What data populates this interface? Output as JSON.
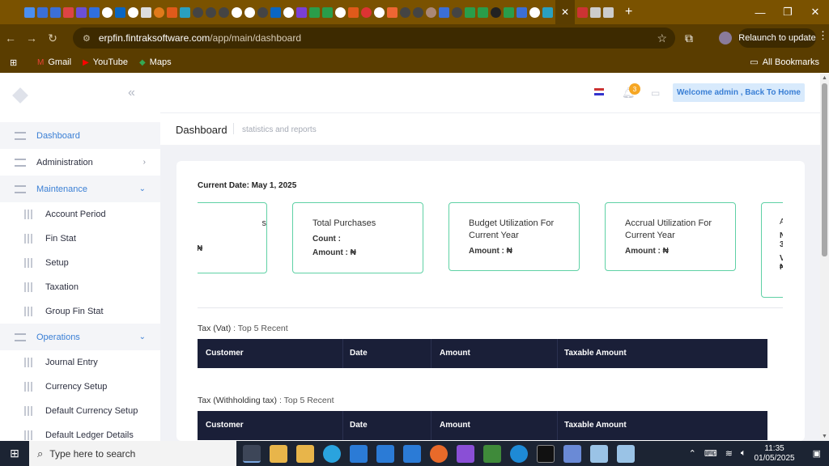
{
  "browser": {
    "url_host": "erpfin.fintraksoftware.com",
    "url_path": "/app/main/dashboard",
    "relaunch_label": "Relaunch to update",
    "bookmarks": [
      {
        "label": "Gmail",
        "icon": "gmail-icon"
      },
      {
        "label": "YouTube",
        "icon": "youtube-icon"
      },
      {
        "label": "Maps",
        "icon": "maps-icon"
      }
    ],
    "all_bookmarks_label": "All Bookmarks"
  },
  "sidebar": {
    "items": [
      {
        "label": "Dashboard",
        "type": "top",
        "active": true
      },
      {
        "label": "Administration",
        "type": "top",
        "chevron": "›"
      },
      {
        "label": "Maintenance",
        "type": "top",
        "active": true,
        "chevron": "⌄"
      },
      {
        "label": "Account Period",
        "type": "sub"
      },
      {
        "label": "Fin Stat",
        "type": "sub"
      },
      {
        "label": "Setup",
        "type": "sub"
      },
      {
        "label": "Taxation",
        "type": "sub"
      },
      {
        "label": "Group Fin Stat",
        "type": "sub"
      },
      {
        "label": "Operations",
        "type": "top",
        "active": true,
        "chevron": "⌄"
      },
      {
        "label": "Journal Entry",
        "type": "sub"
      },
      {
        "label": "Currency Setup",
        "type": "sub"
      },
      {
        "label": "Default Currency Setup",
        "type": "sub"
      },
      {
        "label": "Default Ledger Details",
        "type": "sub"
      }
    ]
  },
  "topbar": {
    "notification_count": "3",
    "welcome_label": "Welcome admin , Back To Home"
  },
  "page": {
    "title": "Dashboard",
    "description": "statistics and reports"
  },
  "dashboard": {
    "current_date": "Current Date: May 1, 2025",
    "stat_partial_left": {
      "l1": "s",
      "l2": "₦"
    },
    "stats": [
      {
        "title": "Total Purchases",
        "count_label": "Count :",
        "amount_label": "Amount : ₦"
      },
      {
        "title": "Budget Utilization For Current Year",
        "amount_label": "Amount : ₦"
      },
      {
        "title": "Accrual Utilization For Current Year",
        "amount_label": "Amount : ₦"
      }
    ],
    "stat_partial_right": {
      "l1": "A",
      "l2": "N",
      "l3": "3",
      "l4": "V",
      "l5": "₦"
    },
    "tables": [
      {
        "title": "Tax (Vat)",
        "subtitle": " : Top 5 Recent",
        "columns": [
          "Customer",
          "Date",
          "Amount",
          "Taxable Amount"
        ]
      },
      {
        "title": "Tax (Withholding tax)",
        "subtitle": " : Top 5 Recent",
        "columns": [
          "Customer",
          "Date",
          "Amount",
          "Taxable Amount"
        ]
      }
    ]
  },
  "taskbar": {
    "search_placeholder": "Type here to search",
    "time": "11:35",
    "date": "01/05/2025"
  }
}
